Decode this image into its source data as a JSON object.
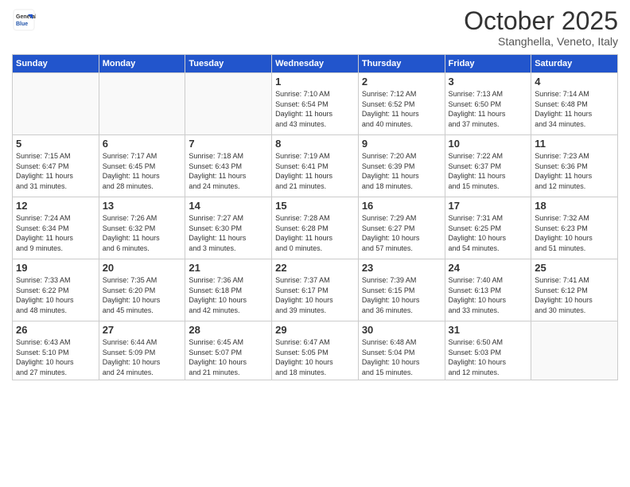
{
  "logo": {
    "general": "General",
    "blue": "Blue"
  },
  "header": {
    "month": "October 2025",
    "location": "Stanghella, Veneto, Italy"
  },
  "weekdays": [
    "Sunday",
    "Monday",
    "Tuesday",
    "Wednesday",
    "Thursday",
    "Friday",
    "Saturday"
  ],
  "weeks": [
    [
      {
        "day": "",
        "info": ""
      },
      {
        "day": "",
        "info": ""
      },
      {
        "day": "",
        "info": ""
      },
      {
        "day": "1",
        "info": "Sunrise: 7:10 AM\nSunset: 6:54 PM\nDaylight: 11 hours\nand 43 minutes."
      },
      {
        "day": "2",
        "info": "Sunrise: 7:12 AM\nSunset: 6:52 PM\nDaylight: 11 hours\nand 40 minutes."
      },
      {
        "day": "3",
        "info": "Sunrise: 7:13 AM\nSunset: 6:50 PM\nDaylight: 11 hours\nand 37 minutes."
      },
      {
        "day": "4",
        "info": "Sunrise: 7:14 AM\nSunset: 6:48 PM\nDaylight: 11 hours\nand 34 minutes."
      }
    ],
    [
      {
        "day": "5",
        "info": "Sunrise: 7:15 AM\nSunset: 6:47 PM\nDaylight: 11 hours\nand 31 minutes."
      },
      {
        "day": "6",
        "info": "Sunrise: 7:17 AM\nSunset: 6:45 PM\nDaylight: 11 hours\nand 28 minutes."
      },
      {
        "day": "7",
        "info": "Sunrise: 7:18 AM\nSunset: 6:43 PM\nDaylight: 11 hours\nand 24 minutes."
      },
      {
        "day": "8",
        "info": "Sunrise: 7:19 AM\nSunset: 6:41 PM\nDaylight: 11 hours\nand 21 minutes."
      },
      {
        "day": "9",
        "info": "Sunrise: 7:20 AM\nSunset: 6:39 PM\nDaylight: 11 hours\nand 18 minutes."
      },
      {
        "day": "10",
        "info": "Sunrise: 7:22 AM\nSunset: 6:37 PM\nDaylight: 11 hours\nand 15 minutes."
      },
      {
        "day": "11",
        "info": "Sunrise: 7:23 AM\nSunset: 6:36 PM\nDaylight: 11 hours\nand 12 minutes."
      }
    ],
    [
      {
        "day": "12",
        "info": "Sunrise: 7:24 AM\nSunset: 6:34 PM\nDaylight: 11 hours\nand 9 minutes."
      },
      {
        "day": "13",
        "info": "Sunrise: 7:26 AM\nSunset: 6:32 PM\nDaylight: 11 hours\nand 6 minutes."
      },
      {
        "day": "14",
        "info": "Sunrise: 7:27 AM\nSunset: 6:30 PM\nDaylight: 11 hours\nand 3 minutes."
      },
      {
        "day": "15",
        "info": "Sunrise: 7:28 AM\nSunset: 6:28 PM\nDaylight: 11 hours\nand 0 minutes."
      },
      {
        "day": "16",
        "info": "Sunrise: 7:29 AM\nSunset: 6:27 PM\nDaylight: 10 hours\nand 57 minutes."
      },
      {
        "day": "17",
        "info": "Sunrise: 7:31 AM\nSunset: 6:25 PM\nDaylight: 10 hours\nand 54 minutes."
      },
      {
        "day": "18",
        "info": "Sunrise: 7:32 AM\nSunset: 6:23 PM\nDaylight: 10 hours\nand 51 minutes."
      }
    ],
    [
      {
        "day": "19",
        "info": "Sunrise: 7:33 AM\nSunset: 6:22 PM\nDaylight: 10 hours\nand 48 minutes."
      },
      {
        "day": "20",
        "info": "Sunrise: 7:35 AM\nSunset: 6:20 PM\nDaylight: 10 hours\nand 45 minutes."
      },
      {
        "day": "21",
        "info": "Sunrise: 7:36 AM\nSunset: 6:18 PM\nDaylight: 10 hours\nand 42 minutes."
      },
      {
        "day": "22",
        "info": "Sunrise: 7:37 AM\nSunset: 6:17 PM\nDaylight: 10 hours\nand 39 minutes."
      },
      {
        "day": "23",
        "info": "Sunrise: 7:39 AM\nSunset: 6:15 PM\nDaylight: 10 hours\nand 36 minutes."
      },
      {
        "day": "24",
        "info": "Sunrise: 7:40 AM\nSunset: 6:13 PM\nDaylight: 10 hours\nand 33 minutes."
      },
      {
        "day": "25",
        "info": "Sunrise: 7:41 AM\nSunset: 6:12 PM\nDaylight: 10 hours\nand 30 minutes."
      }
    ],
    [
      {
        "day": "26",
        "info": "Sunrise: 6:43 AM\nSunset: 5:10 PM\nDaylight: 10 hours\nand 27 minutes."
      },
      {
        "day": "27",
        "info": "Sunrise: 6:44 AM\nSunset: 5:09 PM\nDaylight: 10 hours\nand 24 minutes."
      },
      {
        "day": "28",
        "info": "Sunrise: 6:45 AM\nSunset: 5:07 PM\nDaylight: 10 hours\nand 21 minutes."
      },
      {
        "day": "29",
        "info": "Sunrise: 6:47 AM\nSunset: 5:05 PM\nDaylight: 10 hours\nand 18 minutes."
      },
      {
        "day": "30",
        "info": "Sunrise: 6:48 AM\nSunset: 5:04 PM\nDaylight: 10 hours\nand 15 minutes."
      },
      {
        "day": "31",
        "info": "Sunrise: 6:50 AM\nSunset: 5:03 PM\nDaylight: 10 hours\nand 12 minutes."
      },
      {
        "day": "",
        "info": ""
      }
    ]
  ]
}
